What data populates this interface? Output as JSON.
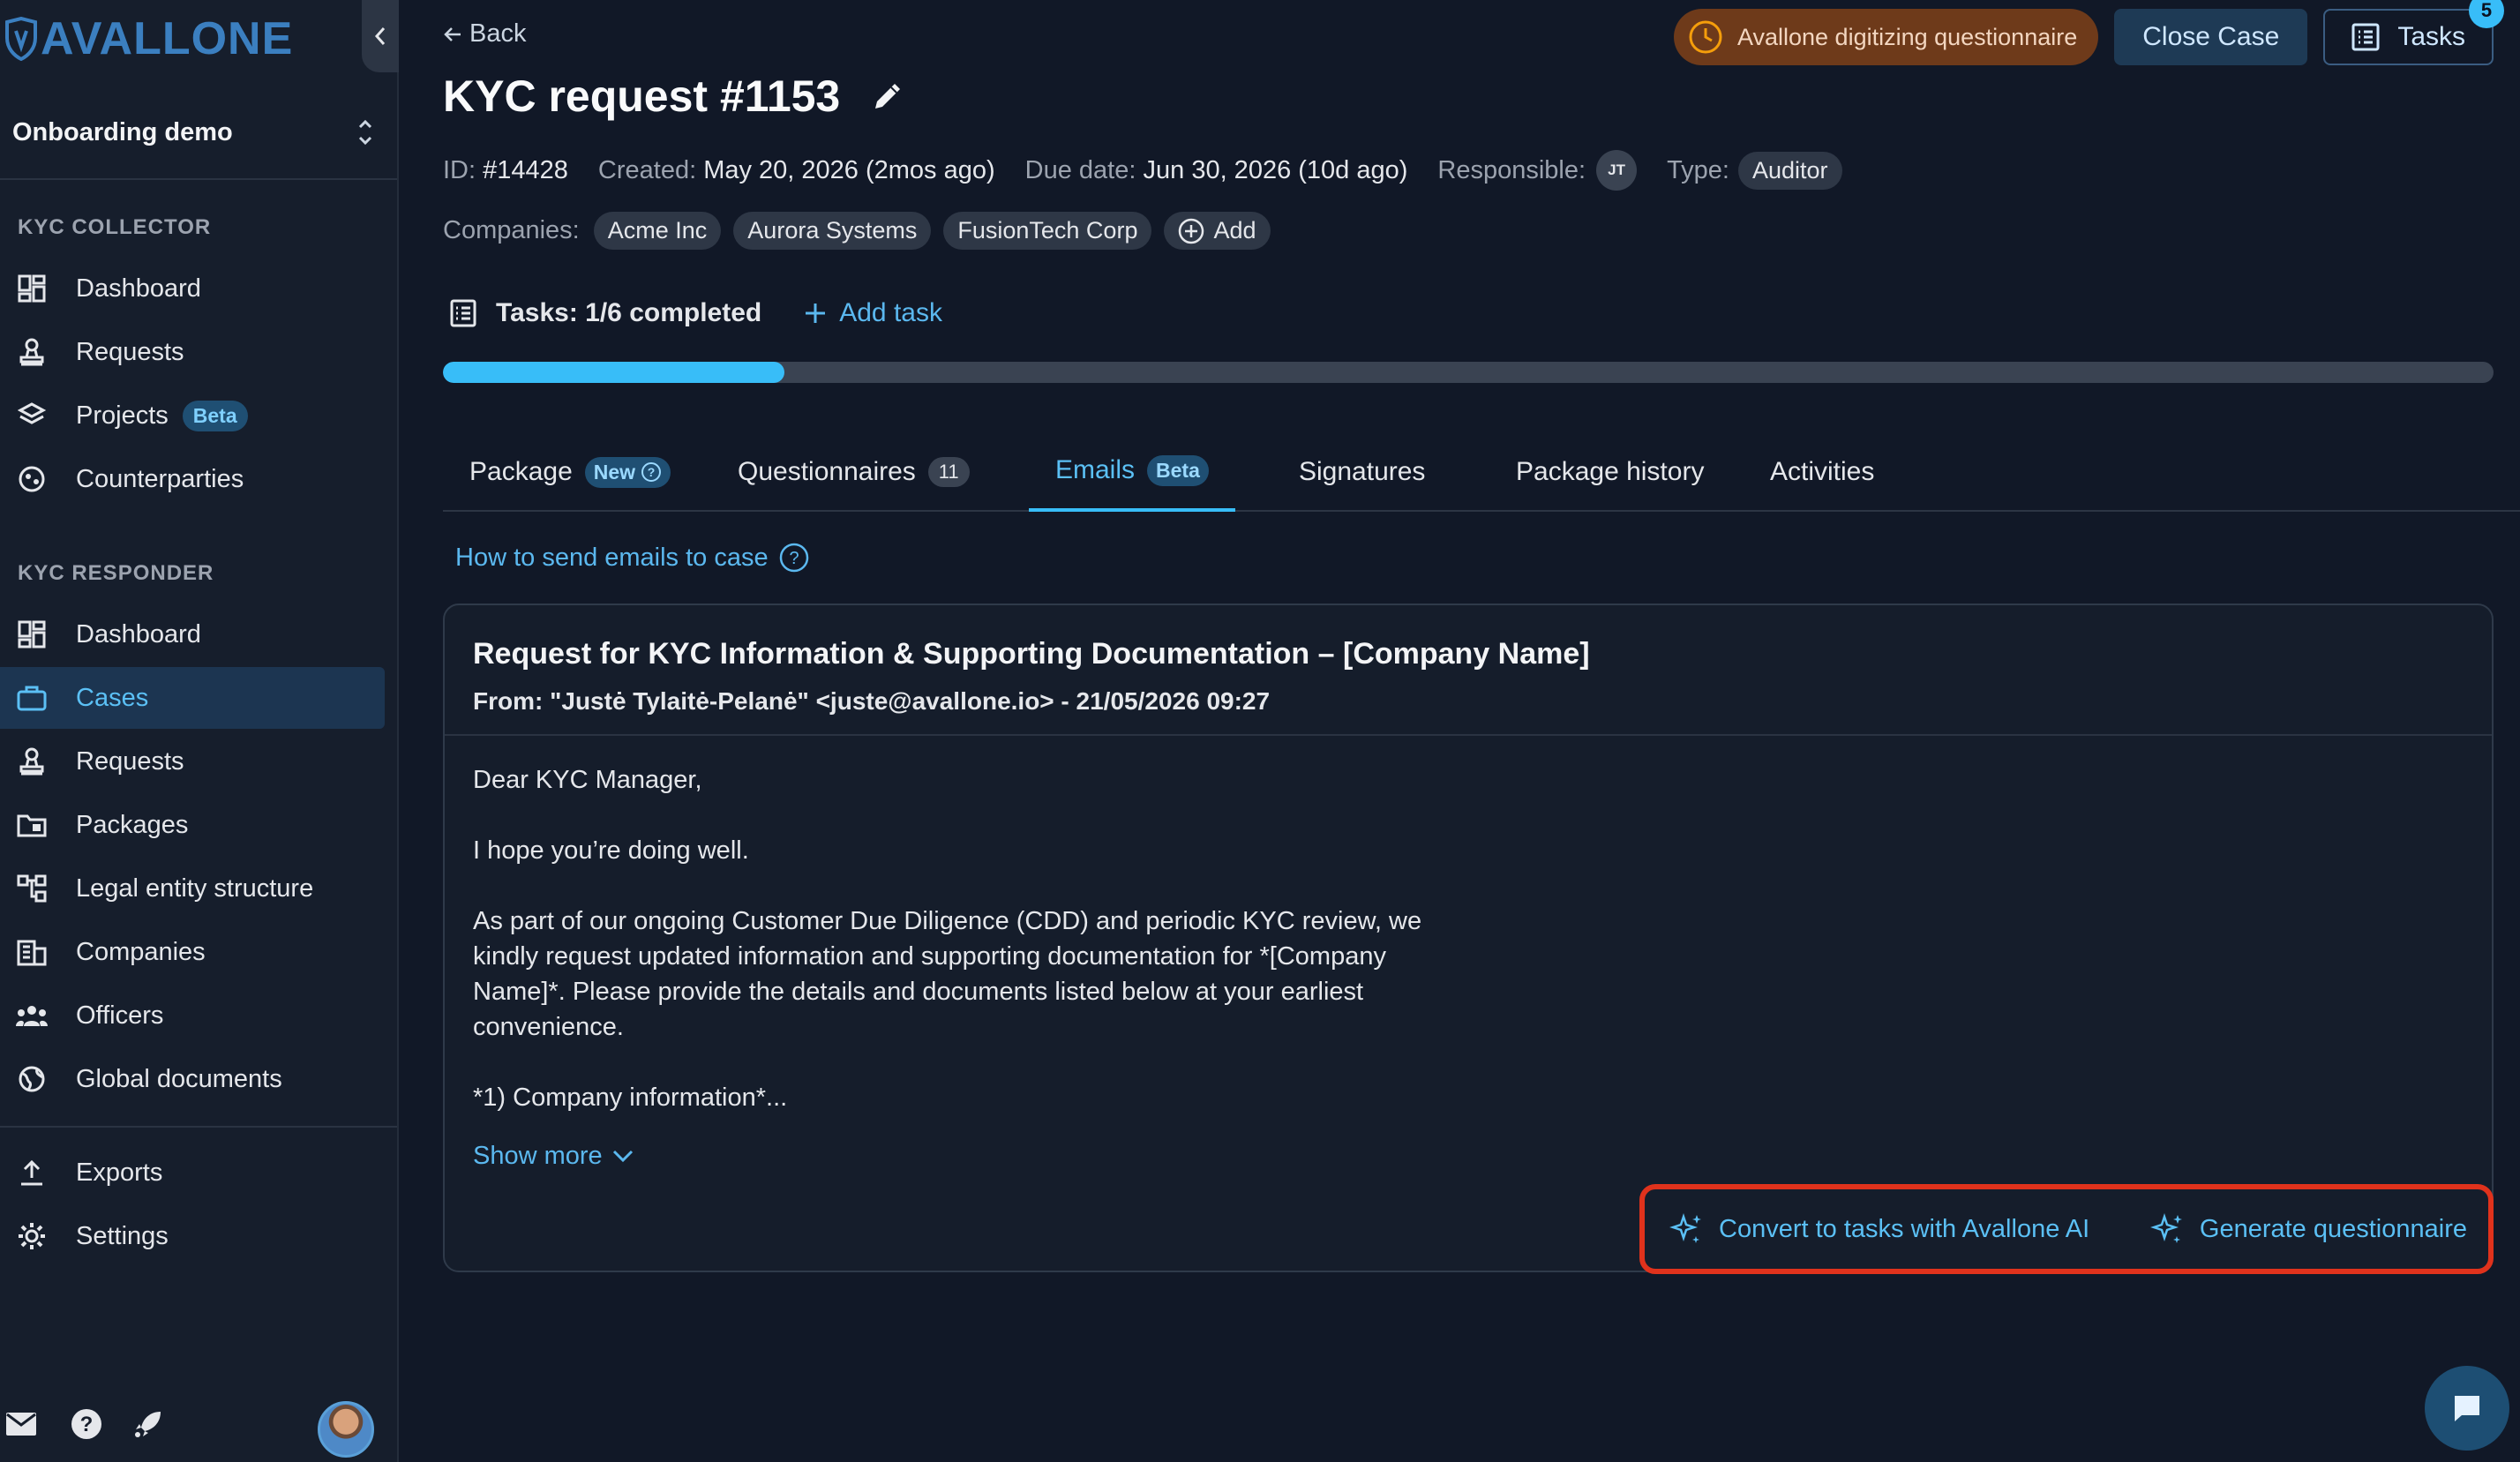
{
  "sidebar": {
    "logo_text": "AVALLONE",
    "workspace": "Onboarding demo",
    "sections": [
      {
        "title": "KYC COLLECTOR",
        "items": [
          {
            "label": "Dashboard",
            "icon": "dashboard-icon"
          },
          {
            "label": "Requests",
            "icon": "stamp-icon"
          },
          {
            "label": "Projects",
            "icon": "layers-icon",
            "badge": "Beta"
          },
          {
            "label": "Counterparties",
            "icon": "counterparties-icon"
          }
        ]
      },
      {
        "title": "KYC RESPONDER",
        "items": [
          {
            "label": "Dashboard",
            "icon": "dashboard-icon"
          },
          {
            "label": "Cases",
            "icon": "briefcase-icon",
            "active": true
          },
          {
            "label": "Requests",
            "icon": "stamp-icon"
          },
          {
            "label": "Packages",
            "icon": "folder-icon"
          },
          {
            "label": "Legal entity structure",
            "icon": "hierarchy-icon"
          },
          {
            "label": "Companies",
            "icon": "building-icon"
          },
          {
            "label": "Officers",
            "icon": "people-icon"
          },
          {
            "label": "Global documents",
            "icon": "globe-icon"
          }
        ]
      }
    ],
    "bottom_items": [
      {
        "label": "Exports",
        "icon": "upload-icon"
      },
      {
        "label": "Settings",
        "icon": "gear-icon"
      }
    ]
  },
  "header": {
    "back_label": "Back",
    "status_pill": "Avallone digitizing questionnaire",
    "close_case_label": "Close Case",
    "tasks_label": "Tasks",
    "tasks_badge": "5",
    "title": "KYC request #1153"
  },
  "meta": {
    "id_label": "ID:",
    "id_value": "#14428",
    "created_label": "Created:",
    "created_value": "May 20, 2026 (2mos ago)",
    "due_label": "Due date:",
    "due_value": "Jun 30, 2026 (10d ago)",
    "responsible_label": "Responsible:",
    "responsible_initials": "JT",
    "type_label": "Type:",
    "type_value": "Auditor"
  },
  "companies": {
    "label": "Companies:",
    "items": [
      "Acme Inc",
      "Aurora Systems",
      "FusionTech Corp"
    ],
    "add_label": "Add"
  },
  "tasks": {
    "label": "Tasks: 1/6 completed",
    "add_label": "Add task",
    "progress_fraction": 0.1667
  },
  "tabs": [
    {
      "label": "Package",
      "badge": "New"
    },
    {
      "label": "Questionnaires",
      "count": "11"
    },
    {
      "label": "Emails",
      "badge": "Beta",
      "active": true
    },
    {
      "label": "Signatures"
    },
    {
      "label": "Package history"
    },
    {
      "label": "Activities"
    }
  ],
  "help_link": "How to send emails to case",
  "email": {
    "subject": "Request for KYC Information & Supporting Documentation – [Company Name]",
    "from": "From: \"Justė Tylaitė-Pelanė\" <juste@avallone.io> - 21/05/2026 09:27",
    "body": [
      "Dear KYC Manager,",
      "I hope you’re doing well.",
      "As part of our ongoing Customer Due Diligence (CDD) and periodic KYC review, we kindly request updated information and supporting documentation for *[Company Name]*. Please provide the details and documents listed below at your earliest convenience.",
      "*1) Company information*..."
    ],
    "show_more_label": "Show more",
    "convert_label": "Convert to tasks with Avallone AI",
    "generate_label": "Generate questionnaire"
  },
  "colors": {
    "accent": "#38bdf8",
    "status_pill_bg": "#6e3a1a",
    "highlight_border": "#e0321c"
  }
}
